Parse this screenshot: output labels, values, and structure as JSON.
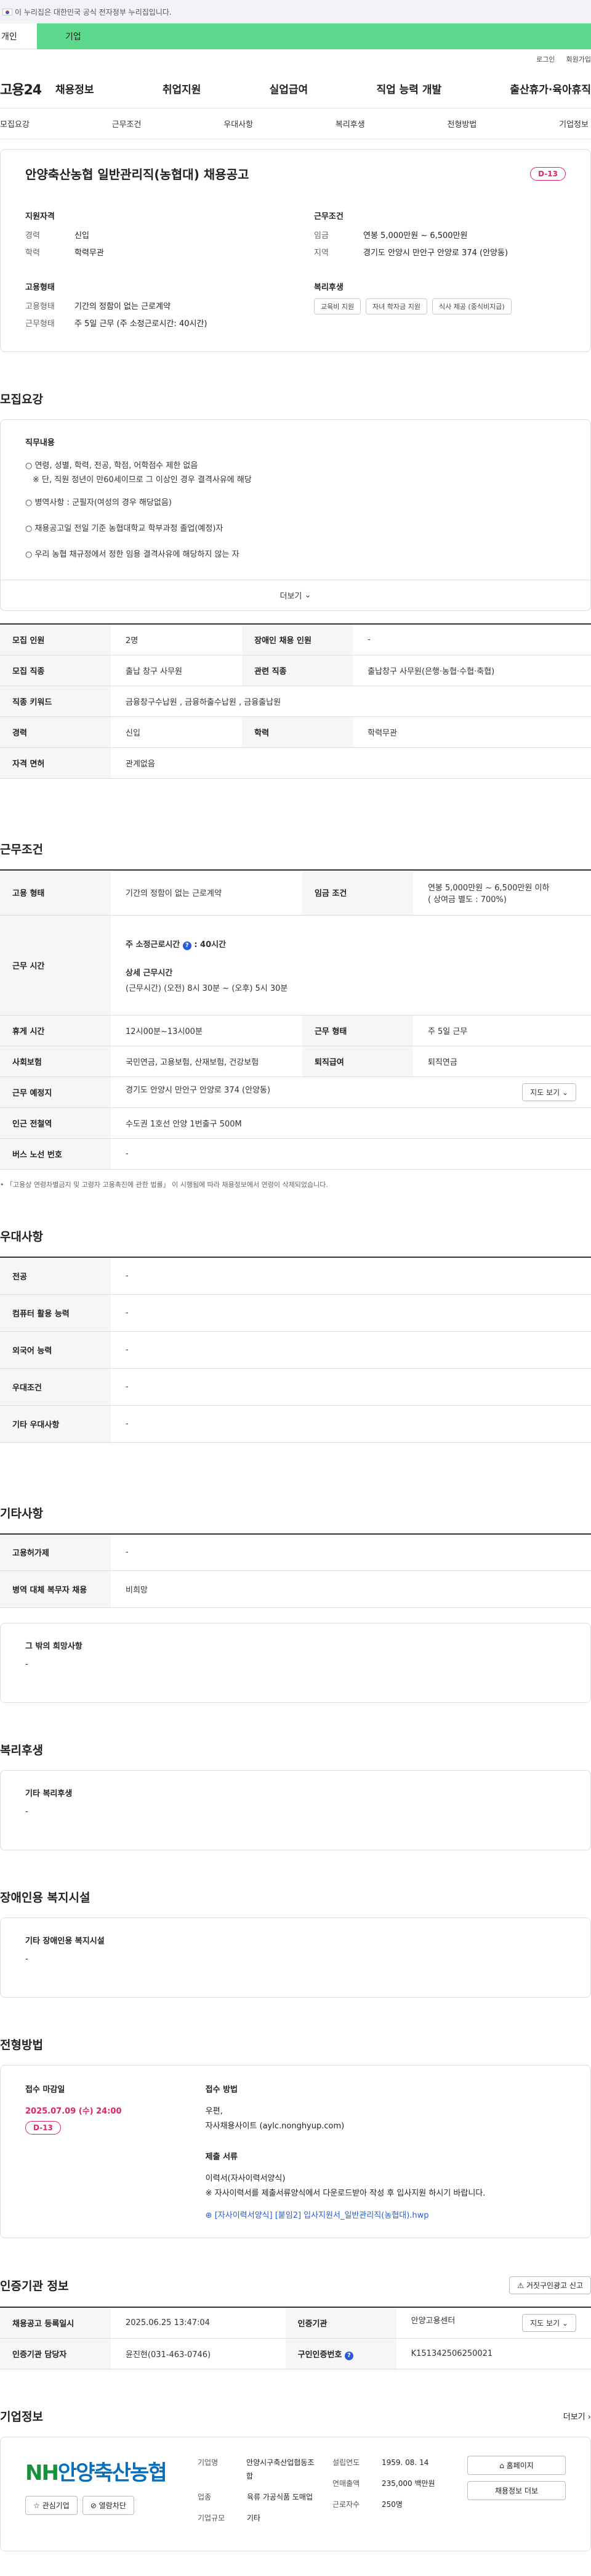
{
  "gov_bar": {
    "text": "이 누리집은 대한민국 공식 전자정부 누리집입니다."
  },
  "top_tabs": {
    "personal": "개인",
    "company": "기업"
  },
  "util": {
    "login": "로그인",
    "join": "회원가입"
  },
  "logo": "고용24",
  "gnb": [
    "채용정보",
    "취업지원",
    "실업급여",
    "직업 능력 개발",
    "출산휴가·육아휴직"
  ],
  "sub_tabs": [
    "모집요강",
    "근무조건",
    "우대사항",
    "복리후생",
    "전형방법",
    "기업정보"
  ],
  "job": {
    "title": "안양축산농협 일반관리직(농협대) 채용공고",
    "dday": "D-13",
    "qualification": {
      "title": "지원자격",
      "rows": [
        {
          "k": "경력",
          "v": "신입"
        },
        {
          "k": "학력",
          "v": "학력무관"
        }
      ]
    },
    "conditions": {
      "title": "근무조건",
      "rows": [
        {
          "k": "임금",
          "v": "연봉 5,000만원 ~ 6,500만원"
        },
        {
          "k": "지역",
          "v": "경기도 안양시 만안구 안양로 374 (안양동)"
        }
      ]
    },
    "employment": {
      "title": "고용형태",
      "rows": [
        {
          "k": "고용형태",
          "v": "기간의 정함이 없는 근로계약"
        },
        {
          "k": "근무형태",
          "v": "주 5일 근무 (주 소정근로시간: 40시간)"
        }
      ]
    },
    "welfare": {
      "title": "복리후생",
      "chips": [
        "교육비 지원",
        "자녀 학자금 지원",
        "식사 제공 (중식비지급)"
      ]
    }
  },
  "recruit_outline": {
    "section": "모집요강",
    "box_title": "직무내용",
    "lines": [
      "○ 연령, 성별, 학력, 전공, 학점, 어학점수 제한 없음",
      "   ※ 단, 직원 정년이 만60세이므로 그 이상인 경우 결격사유에 해당",
      "○ 병역사항 : 군필자(여성의 경우 해당없음)",
      "○ 채용공고일 전일 기준 농협대학교 학부과정 졸업(예정)자",
      "○ 우리 농협 채규정에서 정한 임용 결격사유에 해당하지 않는 자"
    ],
    "more": "더보기"
  },
  "recruit_table": [
    {
      "k1": "모집 인원",
      "v1": "2명",
      "k2": "장애인 채용 인원",
      "v2": "-"
    },
    {
      "k1": "모집 직종",
      "v1": "출납 창구 사무원",
      "k2": "관련 직종",
      "v2": "출납창구 사무원(은행·농협·수협·축협)"
    },
    {
      "k1": "직종 키워드",
      "v1": "금융창구수납원 , 금융하출수납원 , 금융출납원",
      "k2": "",
      "v2": ""
    },
    {
      "k1": "경력",
      "v1": "신입",
      "k2": "학력",
      "v2": "학력무관"
    },
    {
      "k1": "자격 면허",
      "v1": "관계없음",
      "k2": "",
      "v2": ""
    }
  ],
  "work_conditions": {
    "section": "근무조건",
    "employment_type_k": "고용 형태",
    "employment_type_v": "기간의 정함이 없는 근로계약",
    "wage_k": "임금 조건",
    "wage_v1": "연봉 5,000만원 ~ 6,500만원 이하",
    "wage_v2": "( 상여금 별도 : 700%)",
    "hours_k": "근무 시간",
    "hours_title": "주 소정근로시간",
    "hours_value": ": 40시간",
    "hours_detail_title": "상세 근무시간",
    "hours_detail": "(근무시간) (오전) 8시 30분 ~ (오후) 5시 30분",
    "break_k": "휴게 시간",
    "break_v": "12시00분~13시00분",
    "shift_k": "근무 형태",
    "shift_v": "주 5일 근무",
    "insurance_k": "사회보험",
    "insurance_v": "국민연금, 고용보험, 산재보험, 건강보험",
    "severance_k": "퇴직급여",
    "severance_v": "퇴직연금",
    "place_k": "근무 예정지",
    "place_v": "경기도 안양시 만안구 안양로 374 (안양동)",
    "map_btn": "지도 보기",
    "subway_k": "인근 전철역",
    "subway_v": "수도권 1호선 안양 1번출구 500M",
    "bus_k": "버스 노선 번호",
    "bus_v": "-",
    "notice": "「고용상 연령차별금지 및 고령자 고용촉진에 관한 법률」 이 시행됨에 따라 채용정보에서 연령이 삭제되었습니다."
  },
  "preference": {
    "section": "우대사항",
    "rows": [
      {
        "k": "전공",
        "v": "-"
      },
      {
        "k": "컴퓨터 활용 능력",
        "v": "-"
      },
      {
        "k": "외국어 능력",
        "v": "-"
      },
      {
        "k": "우대조건",
        "v": "-"
      },
      {
        "k": "기타 우대사항",
        "v": "-"
      }
    ]
  },
  "etc": {
    "section": "기타사항",
    "rows": [
      {
        "k": "고용허가제",
        "v": "-"
      },
      {
        "k": "병역 대체 복무자 채용",
        "v": "비희망"
      }
    ],
    "other_title": "그 밖의 희망사항",
    "other_value": "-"
  },
  "welfare_section": {
    "section": "복리후생",
    "title": "기타 복리후생",
    "value": "-"
  },
  "disabled_section": {
    "section": "장애인용 복지시설",
    "title": "기타 장애인용 복지시설",
    "value": "-"
  },
  "selection": {
    "section": "전형방법",
    "deadline_title": "접수 마감일",
    "deadline": "2025.07.09 (수) 24:00",
    "dday": "D-13",
    "method_title": "접수 방법",
    "method1": "우편,",
    "method2": "자사채용사이트 (aylc.nonghyup.com)",
    "docs_title": "제출 서류",
    "docs1": "이력서(자사이력서양식)",
    "docs2": "※ 자사이력서를 제출서류양식에서 다운로드받아 작성 후 입사지원 하시기 바랍니다.",
    "attachment": "[자사이력서양식] [붙임2] 입사지원서_일반관리직(농협대).hwp"
  },
  "cert": {
    "section": "인증기관 정보",
    "report_btn": "거짓구인광고 신고",
    "reg_k": "채용공고 등록일시",
    "reg_v": "2025.06.25 13:47:04",
    "agency_k": "인증기관",
    "agency_v": "안양고용센터",
    "map_btn": "지도 보기",
    "manager_k": "인증기관 담당자",
    "manager_v": "윤진현(031-463-0746)",
    "jobid_k": "구인인증번호",
    "jobid_v": "K151342506250021"
  },
  "company": {
    "section": "기업정보",
    "more": "더보기",
    "logo_nh": "NH",
    "logo_name": "안양축산농협",
    "interest_btn": "관심기업",
    "block_btn": "열람차단",
    "type_k": "기업명",
    "type_v": "안양시구축산업협동조합",
    "industry_k": "업종",
    "industry_v": "육류 가공식품 도매업",
    "size_k": "기업규모",
    "size_v": "기타",
    "founded_k": "설립연도",
    "founded_v": "1959. 08. 14",
    "sales_k": "연매출액",
    "sales_v": "235,000 백만원",
    "staff_k": "근로자수",
    "staff_v": "250명",
    "home_btn": "홈페이지",
    "list_btn": "채용정보 더보"
  }
}
